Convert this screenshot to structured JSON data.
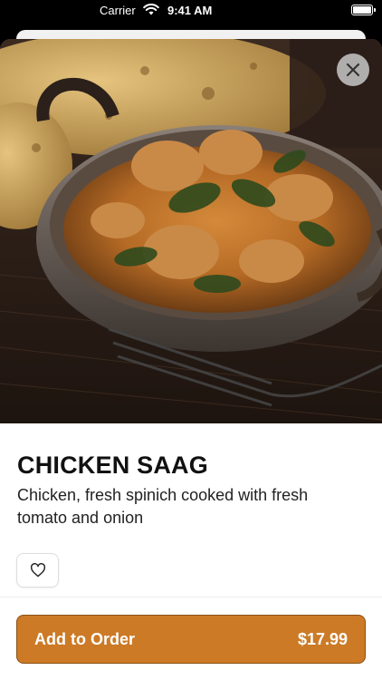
{
  "status_bar": {
    "carrier": "Carrier",
    "time": "9:41 AM"
  },
  "item": {
    "name": "CHICKEN SAAG",
    "description": "Chicken, fresh spinich cooked with fresh tomato and onion",
    "photo_icon": "dish-photo"
  },
  "actions": {
    "close_icon": "close-icon",
    "favorite_icon": "heart-icon",
    "add_label": "Add to Order",
    "price": "$17.99"
  },
  "colors": {
    "accent": "#cc7a26",
    "accent_border": "#8a4f14"
  }
}
